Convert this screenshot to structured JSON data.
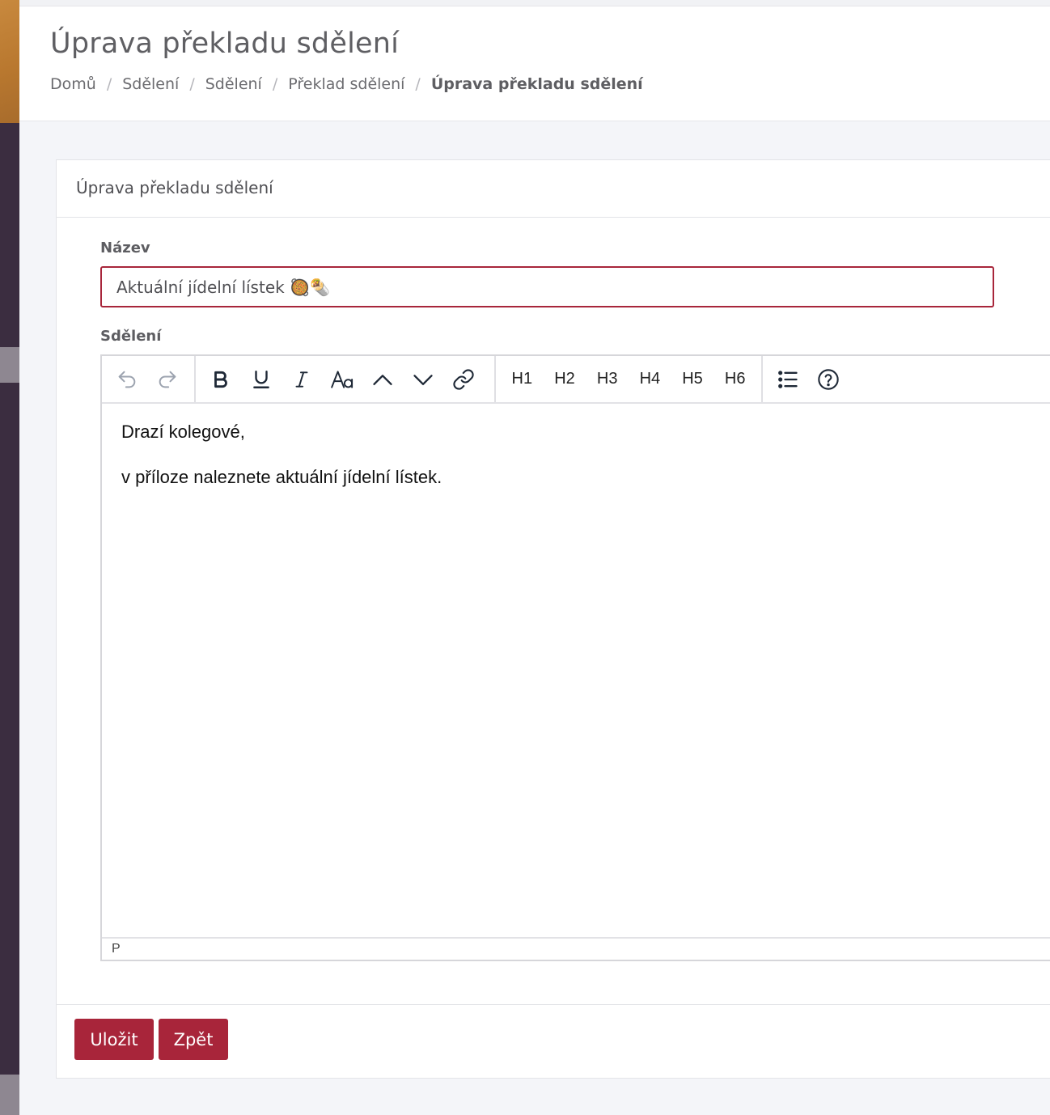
{
  "header": {
    "title": "Úprava překladu sdělení",
    "breadcrumbs": [
      {
        "label": "Domů"
      },
      {
        "label": "Sdělení"
      },
      {
        "label": "Sdělení"
      },
      {
        "label": "Překlad sdělení"
      },
      {
        "label": "Úprava překladu sdělení",
        "current": true
      }
    ],
    "breadcrumb_separator": "/"
  },
  "card": {
    "title": "Úprava překladu sdělení"
  },
  "form": {
    "name_label": "Název",
    "name_value": "Aktuální jídelní lístek 🥘🌯",
    "message_label": "Sdělení"
  },
  "editor": {
    "toolbar": {
      "history": [
        "undo-icon",
        "redo-icon"
      ],
      "formatting": [
        "bold-icon",
        "underline-icon",
        "italic-icon",
        "font-size-icon",
        "superscript-chevron-up-icon",
        "subscript-chevron-down-icon",
        "link-icon"
      ],
      "headings": [
        "H1",
        "H2",
        "H3",
        "H4",
        "H5",
        "H6"
      ],
      "misc": [
        "bullet-list-icon",
        "help-icon"
      ]
    },
    "content": [
      "Drazí kolegové,",
      "v příloze naleznete aktuální jídelní lístek."
    ],
    "status_path": "P"
  },
  "actions": {
    "save_label": "Uložit",
    "back_label": "Zpět"
  },
  "colors": {
    "accent": "#a8253a",
    "sidebar": "#3b2d40",
    "logo": "#b9782f"
  }
}
